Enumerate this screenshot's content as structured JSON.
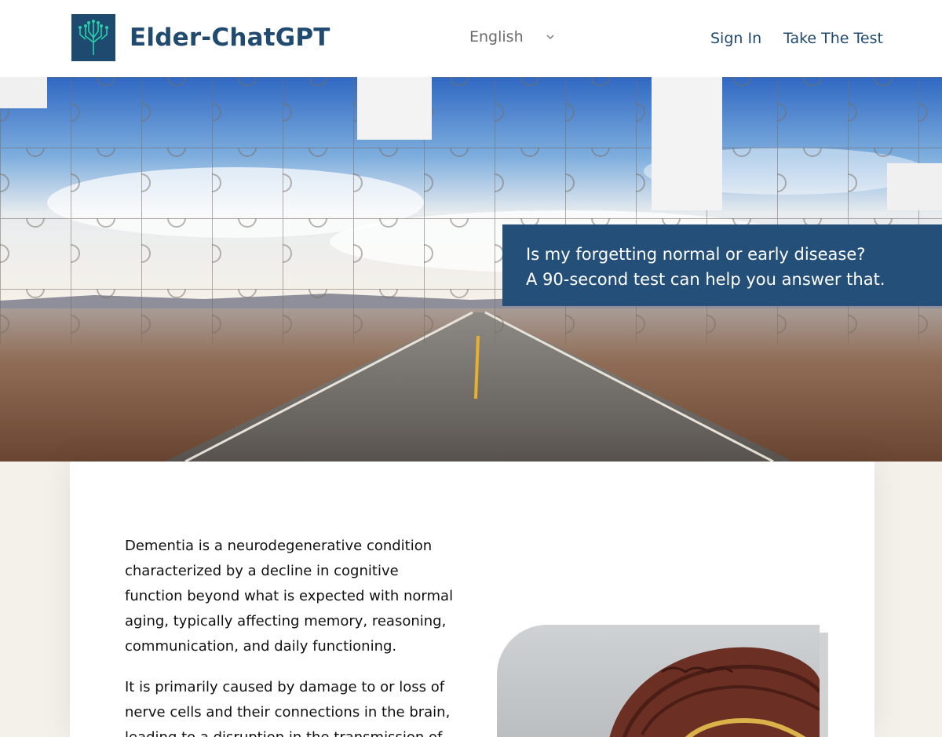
{
  "header": {
    "brand": "Elder-ChatGPT",
    "logo_icon": "circuit-tree-icon",
    "language": {
      "selected": "English"
    },
    "nav": {
      "sign_in": "Sign In",
      "take_test": "Take The Test"
    }
  },
  "hero": {
    "callout_line1": "Is my forgetting normal or early disease?",
    "callout_line2": "A 90-second test can help you answer that."
  },
  "content": {
    "paragraph1": "Dementia is a neurodegenerative condition characterized by a decline in cognitive function beyond what is expected with normal aging, typically affecting memory, reasoning, communication, and daily functioning.",
    "paragraph2": "It is primarily caused by damage to or loss of nerve cells and their connections in the brain, leading to a disruption in the transmission of"
  },
  "colors": {
    "brand_blue": "#204a6f",
    "callout_bg": "#244f78",
    "logo_accent": "#2bd0a8"
  }
}
